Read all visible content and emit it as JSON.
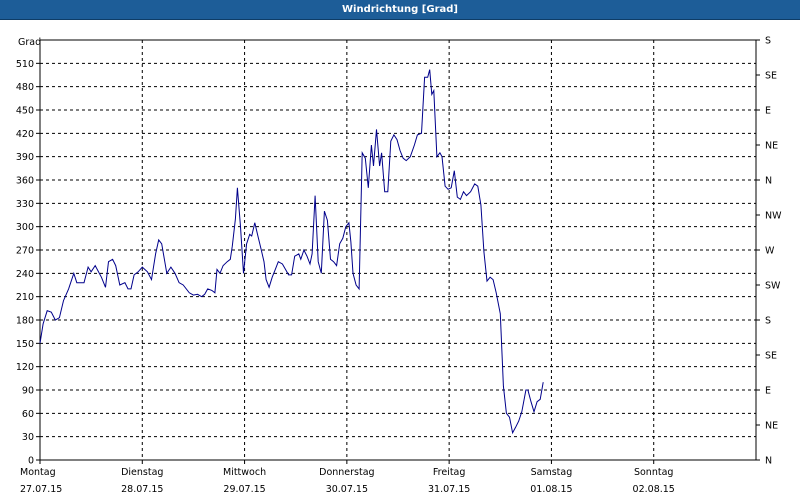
{
  "window": {
    "title": "Windrichtung [Grad]"
  },
  "colors": {
    "titlebar": "#1d5d98",
    "line": "#00008b",
    "grid": "#000000"
  },
  "chart_data": {
    "type": "line",
    "title": "Windrichtung [Grad]",
    "ylabel": "Grad",
    "ylim": [
      0,
      540
    ],
    "yticks": [
      0,
      30,
      60,
      90,
      120,
      150,
      180,
      210,
      240,
      270,
      300,
      330,
      360,
      390,
      420,
      450,
      480,
      510
    ],
    "right_axis_labels": [
      {
        "value": 0,
        "label": "N"
      },
      {
        "value": 45,
        "label": "NE"
      },
      {
        "value": 90,
        "label": "E"
      },
      {
        "value": 135,
        "label": "SE"
      },
      {
        "value": 180,
        "label": "S"
      },
      {
        "value": 225,
        "label": "SW"
      },
      {
        "value": 270,
        "label": "W"
      },
      {
        "value": 315,
        "label": "NW"
      },
      {
        "value": 360,
        "label": "N"
      },
      {
        "value": 405,
        "label": "NE"
      },
      {
        "value": 450,
        "label": "E"
      },
      {
        "value": 495,
        "label": "SE"
      },
      {
        "value": 540,
        "label": "S"
      }
    ],
    "xlim": [
      0,
      7
    ],
    "day_labels": [
      {
        "day": "Montag",
        "date": "27.07.15"
      },
      {
        "day": "Dienstag",
        "date": "28.07.15"
      },
      {
        "day": "Mittwoch",
        "date": "29.07.15"
      },
      {
        "day": "Donnerstag",
        "date": "30.07.15"
      },
      {
        "day": "Freitag",
        "date": "31.07.15"
      },
      {
        "day": "Samstag",
        "date": "01.08.15"
      },
      {
        "day": "Sonntag",
        "date": "02.08.15"
      }
    ],
    "grid": true,
    "series": [
      {
        "values": [
          [
            0.0,
            150
          ],
          [
            0.03,
            175
          ],
          [
            0.07,
            192
          ],
          [
            0.11,
            190
          ],
          [
            0.15,
            180
          ],
          [
            0.19,
            183
          ],
          [
            0.23,
            205
          ],
          [
            0.28,
            220
          ],
          [
            0.33,
            240
          ],
          [
            0.36,
            228
          ],
          [
            0.43,
            228
          ],
          [
            0.47,
            248
          ],
          [
            0.5,
            242
          ],
          [
            0.54,
            250
          ],
          [
            0.6,
            235
          ],
          [
            0.64,
            222
          ],
          [
            0.67,
            255
          ],
          [
            0.71,
            258
          ],
          [
            0.74,
            250
          ],
          [
            0.78,
            225
          ],
          [
            0.83,
            228
          ],
          [
            0.86,
            220
          ],
          [
            0.89,
            220
          ],
          [
            0.92,
            238
          ],
          [
            0.96,
            242
          ],
          [
            1.0,
            248
          ],
          [
            1.05,
            242
          ],
          [
            1.09,
            232
          ],
          [
            1.13,
            265
          ],
          [
            1.16,
            283
          ],
          [
            1.19,
            278
          ],
          [
            1.24,
            240
          ],
          [
            1.28,
            248
          ],
          [
            1.32,
            240
          ],
          [
            1.36,
            228
          ],
          [
            1.4,
            225
          ],
          [
            1.46,
            215
          ],
          [
            1.5,
            212
          ],
          [
            1.54,
            213
          ],
          [
            1.58,
            210
          ],
          [
            1.61,
            213
          ],
          [
            1.64,
            220
          ],
          [
            1.68,
            218
          ],
          [
            1.71,
            215
          ],
          [
            1.73,
            245
          ],
          [
            1.76,
            240
          ],
          [
            1.79,
            250
          ],
          [
            1.83,
            255
          ],
          [
            1.86,
            258
          ],
          [
            1.88,
            275
          ],
          [
            1.91,
            310
          ],
          [
            1.93,
            350
          ],
          [
            1.96,
            300
          ],
          [
            1.99,
            240
          ],
          [
            2.02,
            278
          ],
          [
            2.05,
            290
          ],
          [
            2.07,
            288
          ],
          [
            2.1,
            305
          ],
          [
            2.13,
            288
          ],
          [
            2.16,
            272
          ],
          [
            2.19,
            255
          ],
          [
            2.21,
            232
          ],
          [
            2.24,
            222
          ],
          [
            2.27,
            235
          ],
          [
            2.3,
            245
          ],
          [
            2.33,
            255
          ],
          [
            2.37,
            252
          ],
          [
            2.4,
            245
          ],
          [
            2.43,
            238
          ],
          [
            2.46,
            238
          ],
          [
            2.49,
            262
          ],
          [
            2.53,
            265
          ],
          [
            2.55,
            258
          ],
          [
            2.58,
            270
          ],
          [
            2.61,
            262
          ],
          [
            2.64,
            252
          ],
          [
            2.66,
            265
          ],
          [
            2.69,
            340
          ],
          [
            2.72,
            255
          ],
          [
            2.75,
            240
          ],
          [
            2.78,
            320
          ],
          [
            2.81,
            308
          ],
          [
            2.84,
            258
          ],
          [
            2.87,
            255
          ],
          [
            2.9,
            250
          ],
          [
            2.93,
            278
          ],
          [
            2.96,
            285
          ],
          [
            2.99,
            300
          ],
          [
            3.02,
            305
          ],
          [
            3.04,
            280
          ],
          [
            3.06,
            240
          ],
          [
            3.09,
            225
          ],
          [
            3.12,
            220
          ],
          [
            3.15,
            395
          ],
          [
            3.18,
            388
          ],
          [
            3.21,
            350
          ],
          [
            3.24,
            405
          ],
          [
            3.26,
            378
          ],
          [
            3.29,
            425
          ],
          [
            3.32,
            378
          ],
          [
            3.34,
            395
          ],
          [
            3.37,
            345
          ],
          [
            3.4,
            345
          ],
          [
            3.43,
            410
          ],
          [
            3.46,
            418
          ],
          [
            3.49,
            412
          ],
          [
            3.52,
            398
          ],
          [
            3.55,
            388
          ],
          [
            3.58,
            385
          ],
          [
            3.62,
            390
          ],
          [
            3.66,
            405
          ],
          [
            3.69,
            418
          ],
          [
            3.73,
            420
          ],
          [
            3.76,
            492
          ],
          [
            3.79,
            492
          ],
          [
            3.81,
            502
          ],
          [
            3.83,
            470
          ],
          [
            3.85,
            475
          ],
          [
            3.88,
            390
          ],
          [
            3.91,
            395
          ],
          [
            3.93,
            390
          ],
          [
            3.96,
            352
          ],
          [
            3.99,
            348
          ],
          [
            4.02,
            350
          ],
          [
            4.05,
            372
          ],
          [
            4.08,
            338
          ],
          [
            4.11,
            335
          ],
          [
            4.14,
            345
          ],
          [
            4.17,
            340
          ],
          [
            4.21,
            345
          ],
          [
            4.25,
            355
          ],
          [
            4.28,
            352
          ],
          [
            4.31,
            328
          ],
          [
            4.34,
            268
          ],
          [
            4.37,
            230
          ],
          [
            4.4,
            235
          ],
          [
            4.43,
            232
          ],
          [
            4.46,
            215
          ],
          [
            4.5,
            188
          ],
          [
            4.53,
            95
          ],
          [
            4.56,
            60
          ],
          [
            4.59,
            55
          ],
          [
            4.62,
            35
          ],
          [
            4.65,
            42
          ],
          [
            4.68,
            50
          ],
          [
            4.71,
            62
          ],
          [
            4.75,
            90
          ],
          [
            4.77,
            90
          ],
          [
            4.8,
            75
          ],
          [
            4.83,
            62
          ],
          [
            4.86,
            75
          ],
          [
            4.89,
            78
          ],
          [
            4.92,
            100
          ]
        ]
      }
    ]
  }
}
